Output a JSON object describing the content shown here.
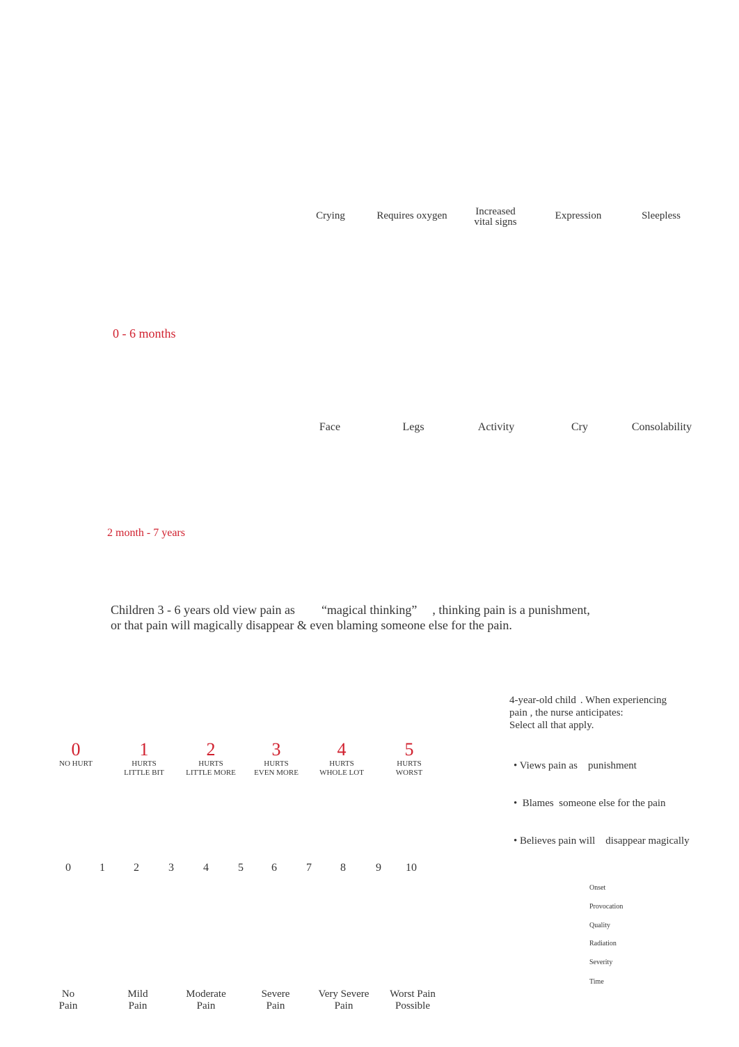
{
  "indicators_row1": [
    "Crying",
    "Requires oxygen",
    "Increased vital signs",
    "Expression",
    "Sleepless"
  ],
  "age_label_1": "0 - 6 months",
  "indicators_row2": [
    "Face",
    "Legs",
    "Activity",
    "Cry",
    "Consolability"
  ],
  "age_label_2": "2 month - 7 years",
  "magical_thinking": {
    "line1_a": "Children 3 - 6 years old view pain as",
    "line1_b": "“magical thinking”",
    "line1_c": ", thinking pain is a punishment,",
    "line2": "or that pain will magically disappear & even blaming someone else for the pain."
  },
  "question": {
    "line1_a": "4-year-old child",
    "line1_b": ". When experiencing",
    "line2": "pain , the nurse anticipates:",
    "line3": "Select all that apply.",
    "options": [
      "• Views pain as    punishment",
      "•  Blames  someone else for the pain",
      "• Believes pain will    disappear magically"
    ]
  },
  "faces_scale": [
    {
      "num": "0",
      "l1": "NO HURT",
      "l2": ""
    },
    {
      "num": "1",
      "l1": "HURTS",
      "l2": "LITTLE BIT"
    },
    {
      "num": "2",
      "l1": "HURTS",
      "l2": "LITTLE MORE"
    },
    {
      "num": "3",
      "l1": "HURTS",
      "l2": "EVEN MORE"
    },
    {
      "num": "4",
      "l1": "HURTS",
      "l2": "WHOLE LOT"
    },
    {
      "num": "5",
      "l1": "HURTS",
      "l2": "WORST"
    }
  ],
  "numeric_scale": [
    "0",
    "1",
    "2",
    "3",
    "4",
    "5",
    "6",
    "7",
    "8",
    "9",
    "10"
  ],
  "pain_labels": [
    {
      "l1": "No",
      "l2": "Pain"
    },
    {
      "l1": "Mild",
      "l2": "Pain"
    },
    {
      "l1": "Moderate",
      "l2": "Pain"
    },
    {
      "l1": "Severe",
      "l2": "Pain"
    },
    {
      "l1": "Very Severe",
      "l2": "Pain"
    },
    {
      "l1": "Worst Pain",
      "l2": "Possible"
    }
  ],
  "opqrst": [
    "Onset",
    "Provocation",
    "Quality",
    "Radiation",
    "Severity",
    "Time"
  ]
}
